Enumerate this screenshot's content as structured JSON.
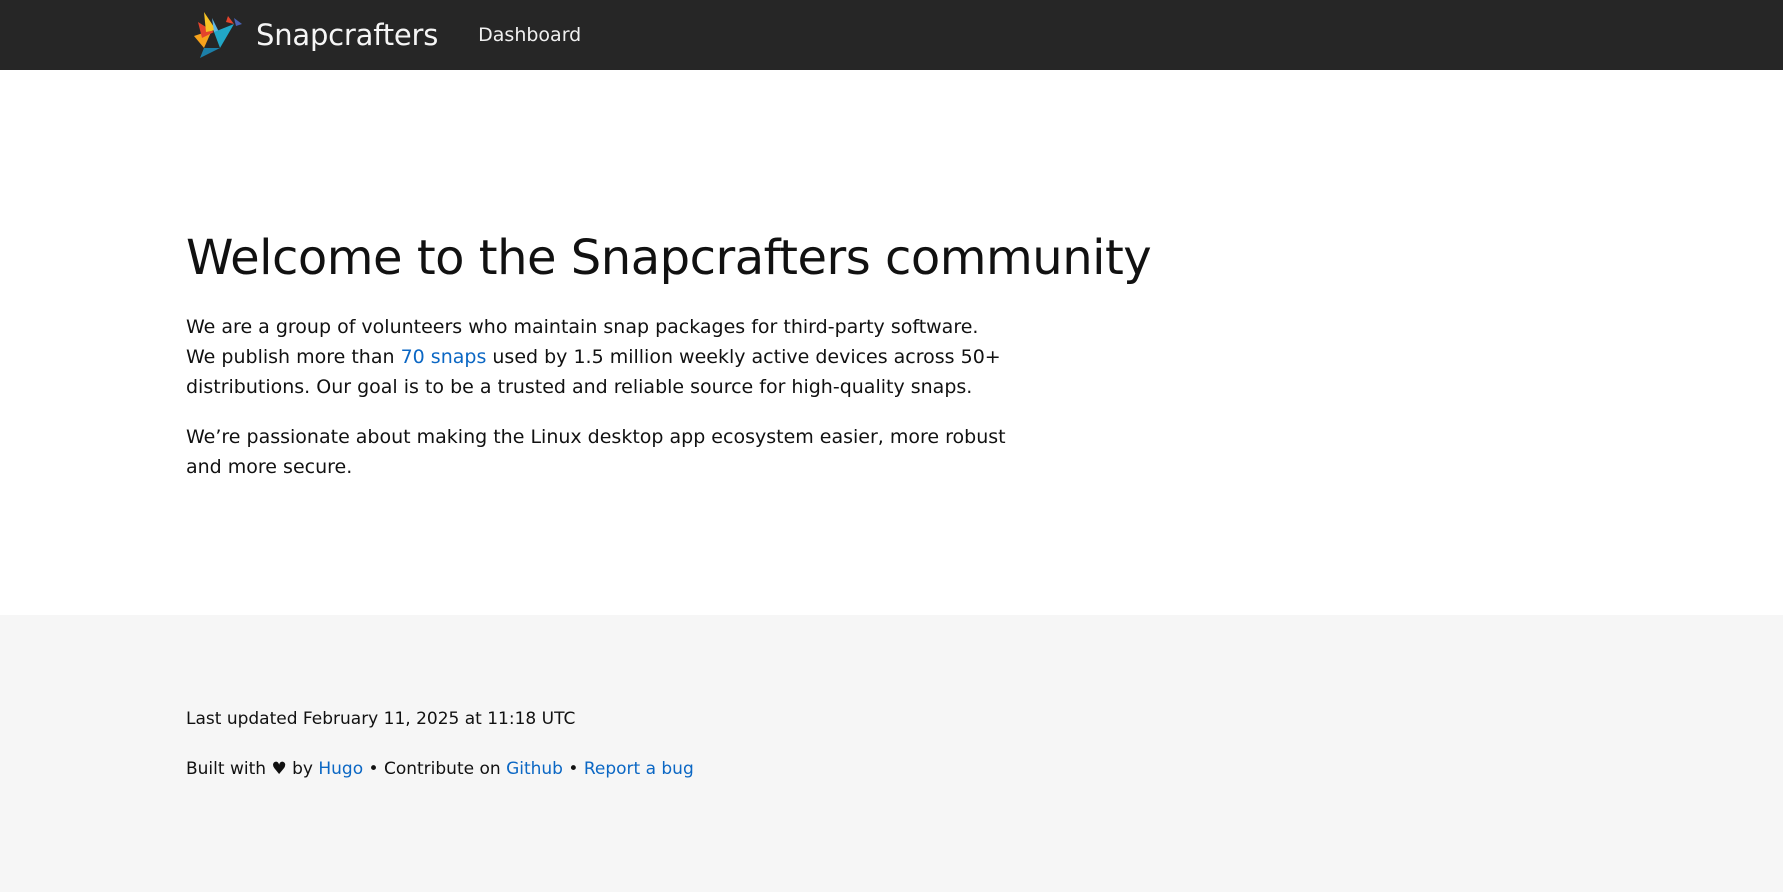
{
  "header": {
    "brand": "Snapcrafters",
    "nav": {
      "dashboard": "Dashboard"
    }
  },
  "main": {
    "title": "Welcome to the Snapcrafters community",
    "p1_before": "We are a group of volunteers who maintain snap packages for third-party software. We publish more than ",
    "p1_link": "70 snaps",
    "p1_after": " used by 1.5 million weekly active devices across 50+ distributions. Our goal is to be a trusted and reliable source for high-quality snaps.",
    "p2": "We’re passionate about making the Linux desktop app ecosystem easier, more robust and more secure."
  },
  "footer": {
    "last_updated": "Last updated February 11, 2025 at 11:18 UTC",
    "built_with": "Built with",
    "heart": "♥",
    "by": "by",
    "hugo": "Hugo",
    "sep1": "•",
    "contribute": "Contribute on",
    "github": "Github",
    "sep2": "•",
    "report_bug": "Report a bug"
  },
  "colors": {
    "header_bg": "#262626",
    "link": "#0b67c4",
    "footer_bg": "#f6f6f6"
  }
}
